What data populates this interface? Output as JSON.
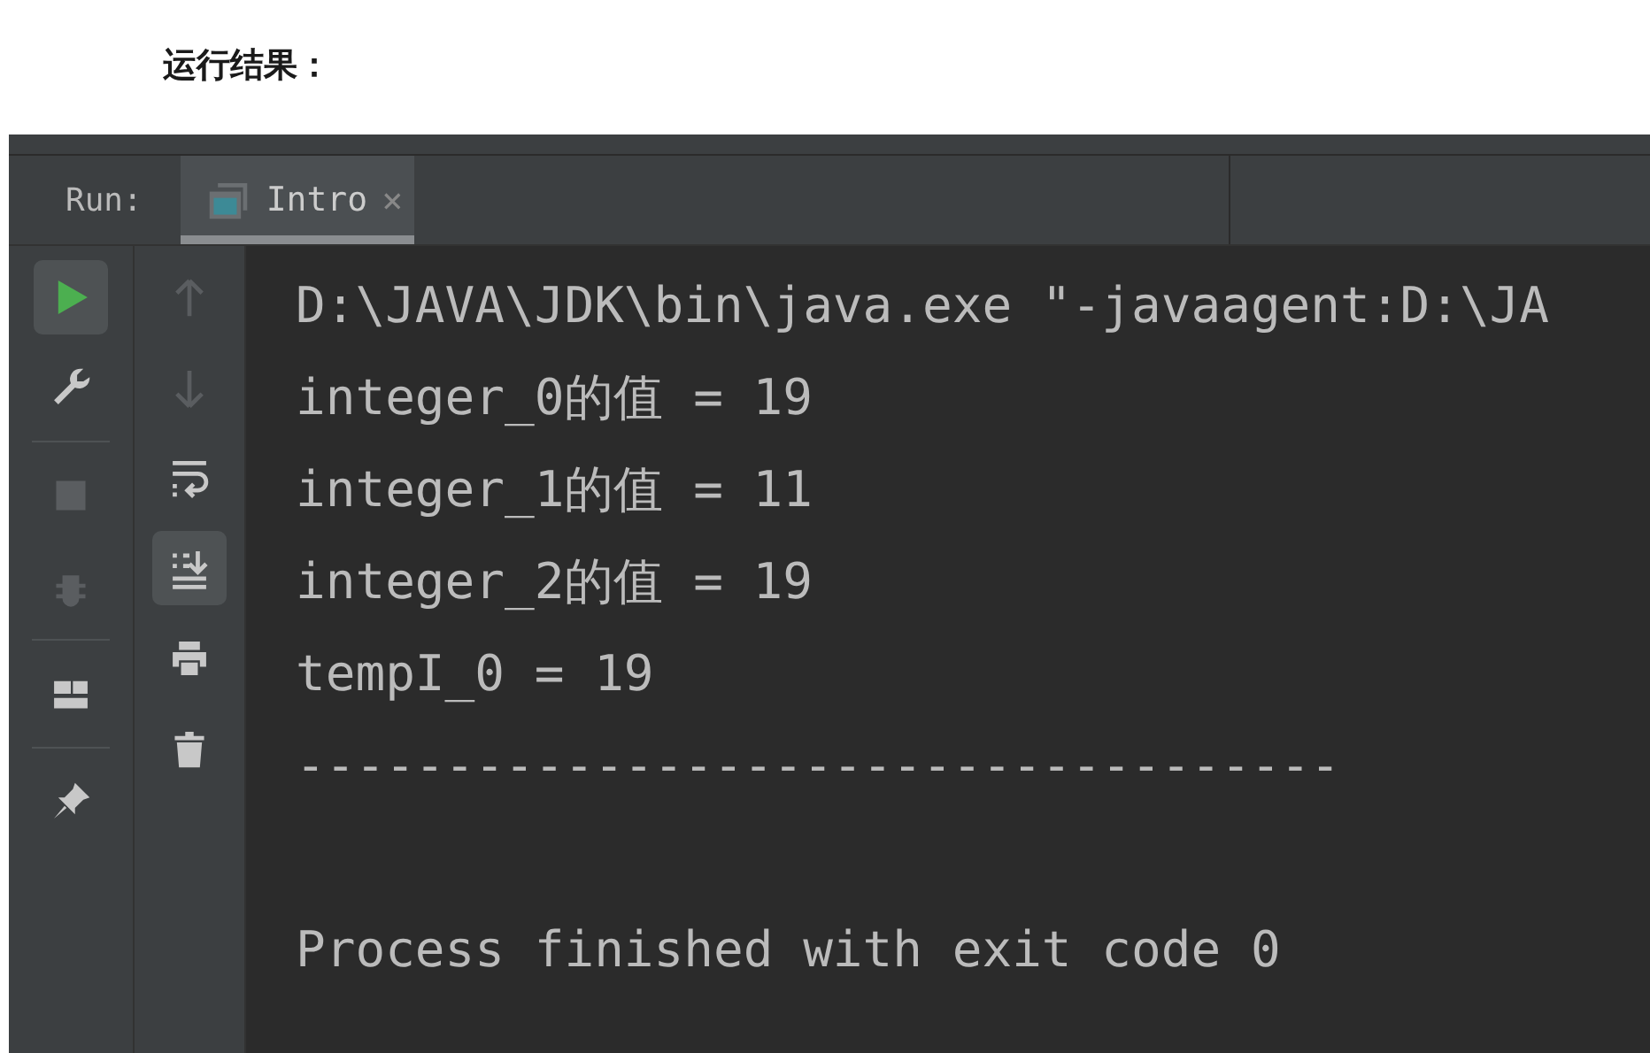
{
  "heading": "运行结果：",
  "run_panel": {
    "label": "Run:",
    "tabs": [
      {
        "label": "Intro",
        "selected": true,
        "close": "×"
      }
    ],
    "main_toolbar": [
      {
        "kind": "run",
        "selected": true,
        "disabled": false
      },
      {
        "kind": "wrench",
        "selected": false,
        "disabled": false
      },
      {
        "kind": "separator"
      },
      {
        "kind": "stop",
        "selected": false,
        "disabled": true
      },
      {
        "kind": "debug",
        "selected": false,
        "disabled": true
      },
      {
        "kind": "separator"
      },
      {
        "kind": "layout",
        "selected": false,
        "disabled": false
      },
      {
        "kind": "separator"
      },
      {
        "kind": "pin",
        "selected": false,
        "disabled": false
      }
    ],
    "console_toolbar": [
      {
        "kind": "up",
        "selected": false,
        "disabled": true
      },
      {
        "kind": "down",
        "selected": false,
        "disabled": true
      },
      {
        "kind": "wrap",
        "selected": false,
        "disabled": false
      },
      {
        "kind": "scroll-end",
        "selected": true,
        "disabled": false
      },
      {
        "kind": "print",
        "selected": false,
        "disabled": false
      },
      {
        "kind": "trash",
        "selected": false,
        "disabled": false
      }
    ],
    "console": {
      "lines": [
        "D:\\JAVA\\JDK\\bin\\java.exe \"-javaagent:D:\\JA",
        "integer_0的值 = 19",
        "integer_1的值 = 11",
        "integer_2的值 = 19",
        "tempI_0 = 19",
        "-----------------------------------"
      ],
      "exit_message": "Process finished with exit code 0"
    }
  }
}
